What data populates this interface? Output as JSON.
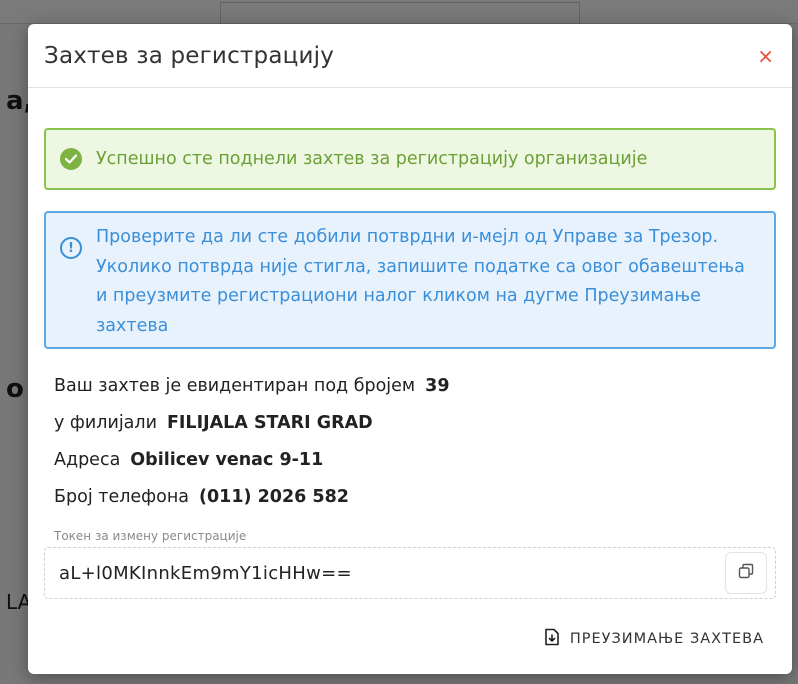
{
  "modal": {
    "title": "Захтев за регистрацију",
    "close_label": "×"
  },
  "success_alert": {
    "icon": "check-circle-icon",
    "text": "Успешно сте поднели захтев за регистрацију организације"
  },
  "info_alert": {
    "icon": "info-circle-icon",
    "text": "Проверите да ли сте добили потврдни и-мејл од Управе за Трезор. Уколико потврда није стигла, запишите податке са овог обавештења и преузмите регистрациони налог кликом на дугме Преузимање захтева"
  },
  "details": {
    "request_label": "Ваш захтев је евидентиран под бројем",
    "request_number": "39",
    "branch_label": "у филијали",
    "branch_value": "FILIJALA STARI GRAD",
    "address_label": "Адреса",
    "address_value": "Obilicev venac 9-11",
    "phone_label": "Број телефона",
    "phone_value": "(011) 2026 582"
  },
  "token": {
    "label": "Токен за измену регистрације",
    "value": "aL+l0MKInnkEm9mY1icHHw=="
  },
  "footer": {
    "download_label": "ПРЕУЗИМАЊЕ ЗАХТЕВА",
    "download_icon": "file-download-icon"
  },
  "colors": {
    "success_border": "#8bc34a",
    "success_bg": "#eef7e1",
    "success_text": "#6aa136",
    "info_border": "#5aa9e6",
    "info_bg": "#e7f2fd",
    "info_text": "#3b8fd9",
    "close": "#e84c3d"
  }
}
